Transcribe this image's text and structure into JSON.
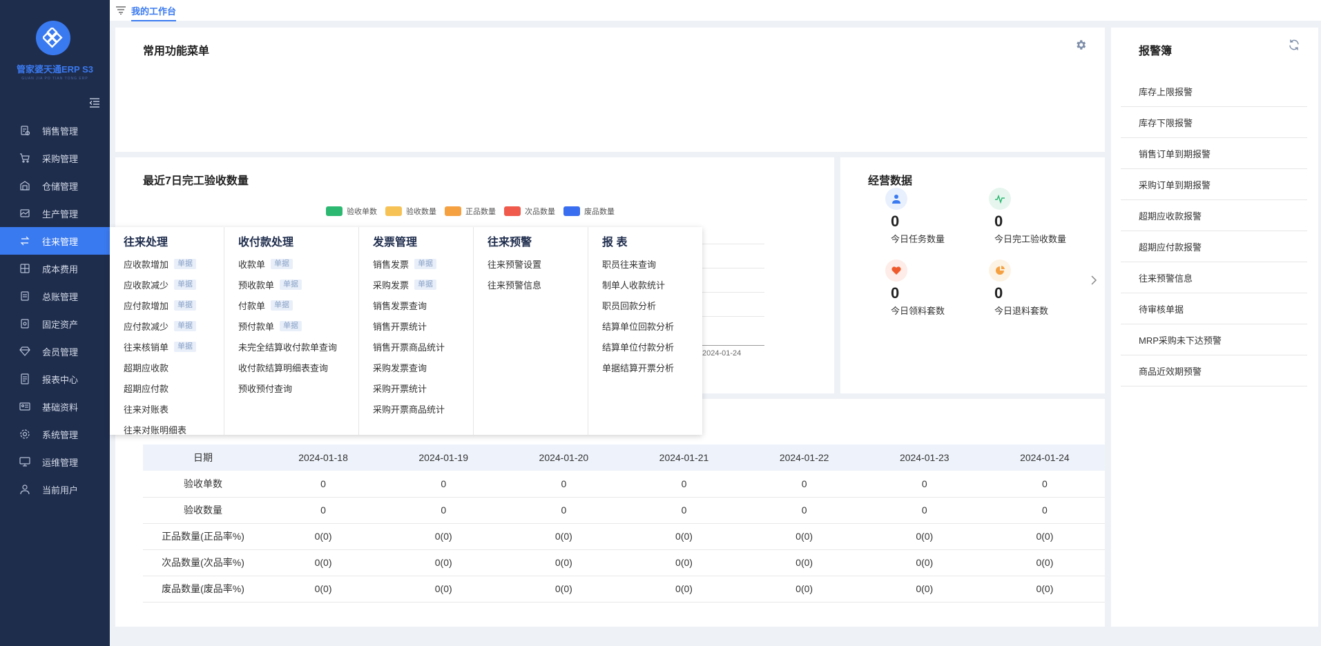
{
  "app": {
    "title": "管家婆天通ERP S3",
    "subtitle": "GUAN JIA PO TIAN TONG ERP"
  },
  "sidebar": {
    "items": [
      {
        "label": "销售管理",
        "icon": "sales-icon"
      },
      {
        "label": "采购管理",
        "icon": "cart-icon"
      },
      {
        "label": "仓储管理",
        "icon": "warehouse-icon"
      },
      {
        "label": "生产管理",
        "icon": "production-icon"
      },
      {
        "label": "往来管理",
        "icon": "exchange-icon",
        "active": true
      },
      {
        "label": "成本费用",
        "icon": "cost-icon"
      },
      {
        "label": "总账管理",
        "icon": "ledger-icon"
      },
      {
        "label": "固定资产",
        "icon": "asset-icon"
      },
      {
        "label": "会员管理",
        "icon": "diamond-icon"
      },
      {
        "label": "报表中心",
        "icon": "report-icon"
      },
      {
        "label": "基础资料",
        "icon": "profile-card-icon"
      },
      {
        "label": "系统管理",
        "icon": "gear-icon"
      },
      {
        "label": "运维管理",
        "icon": "monitor-icon"
      },
      {
        "label": "当前用户",
        "icon": "user-icon"
      }
    ]
  },
  "tabs": {
    "active": "我的工作台"
  },
  "func_panel": {
    "title": "常用功能菜单"
  },
  "chart_panel": {
    "title": "最近7日完工验收数量",
    "x_tick_visible": "2024-01-24"
  },
  "chart_data": {
    "type": "bar",
    "title": "最近7日完工验收数量",
    "categories": [
      "2024-01-18",
      "2024-01-19",
      "2024-01-20",
      "2024-01-21",
      "2024-01-22",
      "2024-01-23",
      "2024-01-24"
    ],
    "series": [
      {
        "name": "验收单数",
        "color": "#2db872",
        "values": [
          0,
          0,
          0,
          0,
          0,
          0,
          0
        ]
      },
      {
        "name": "验收数量",
        "color": "#f7c255",
        "values": [
          0,
          0,
          0,
          0,
          0,
          0,
          0
        ]
      },
      {
        "name": "正品数量",
        "color": "#f5a142",
        "values": [
          0,
          0,
          0,
          0,
          0,
          0,
          0
        ]
      },
      {
        "name": "次品数量",
        "color": "#ef5a4c",
        "values": [
          0,
          0,
          0,
          0,
          0,
          0,
          0
        ]
      },
      {
        "name": "废品数量",
        "color": "#3a6ef0",
        "values": [
          0,
          0,
          0,
          0,
          0,
          0,
          0
        ]
      }
    ],
    "legend": "top-center",
    "grid": true
  },
  "biz_panel": {
    "title": "经营数据",
    "stats": [
      {
        "value": "0",
        "label": "今日任务数量",
        "icon": "person-icon",
        "color": "#3a7af0",
        "bg": "#e8f0fd"
      },
      {
        "value": "0",
        "label": "今日完工验收数量",
        "icon": "activity-icon",
        "color": "#2db872",
        "bg": "#e6f6ee"
      },
      {
        "value": "0",
        "label": "今日领料套数",
        "icon": "heart-icon",
        "color": "#ef5a2c",
        "bg": "#fdece7"
      },
      {
        "value": "0",
        "label": "今日退料套数",
        "icon": "pie-icon",
        "color": "#f5a142",
        "bg": "#fdf3e4"
      }
    ]
  },
  "table": {
    "header": [
      "日期",
      "2024-01-18",
      "2024-01-19",
      "2024-01-20",
      "2024-01-21",
      "2024-01-22",
      "2024-01-23",
      "2024-01-24"
    ],
    "rows": [
      [
        "验收单数",
        "0",
        "0",
        "0",
        "0",
        "0",
        "0",
        "0"
      ],
      [
        "验收数量",
        "0",
        "0",
        "0",
        "0",
        "0",
        "0",
        "0"
      ],
      [
        "正品数量(正品率%)",
        "0(0)",
        "0(0)",
        "0(0)",
        "0(0)",
        "0(0)",
        "0(0)",
        "0(0)"
      ],
      [
        "次品数量(次品率%)",
        "0(0)",
        "0(0)",
        "0(0)",
        "0(0)",
        "0(0)",
        "0(0)",
        "0(0)"
      ],
      [
        "废品数量(废品率%)",
        "0(0)",
        "0(0)",
        "0(0)",
        "0(0)",
        "0(0)",
        "0(0)",
        "0(0)"
      ]
    ]
  },
  "alarm_panel": {
    "title": "报警簿",
    "items": [
      "库存上限报警",
      "库存下限报警",
      "销售订单到期报警",
      "采购订单到期报警",
      "超期应收款报警",
      "超期应付款报警",
      "往来预警信息",
      "待审核单据",
      "MRP采购未下达预警",
      "商品近效期预警"
    ]
  },
  "dropdown": {
    "badge": "单据",
    "columns": [
      {
        "title": "往来处理",
        "items": [
          {
            "label": "应收款增加",
            "badge": true
          },
          {
            "label": "应收款减少",
            "badge": true
          },
          {
            "label": "应付款增加",
            "badge": true
          },
          {
            "label": "应付款减少",
            "badge": true
          },
          {
            "label": "往来核销单",
            "badge": true
          },
          {
            "label": "超期应收款"
          },
          {
            "label": "超期应付款"
          },
          {
            "label": "往来对账表"
          },
          {
            "label": "往来对账明细表"
          }
        ]
      },
      {
        "title": "收付款处理",
        "items": [
          {
            "label": "收款单",
            "badge": true
          },
          {
            "label": "预收款单",
            "badge": true
          },
          {
            "label": "付款单",
            "badge": true
          },
          {
            "label": "预付款单",
            "badge": true
          },
          {
            "label": "未完全结算收付款单查询"
          },
          {
            "label": "收付款结算明细表查询"
          },
          {
            "label": "预收预付查询"
          }
        ]
      },
      {
        "title": "发票管理",
        "items": [
          {
            "label": "销售发票",
            "badge": true
          },
          {
            "label": "采购发票",
            "badge": true
          },
          {
            "label": "销售发票查询"
          },
          {
            "label": "销售开票统计"
          },
          {
            "label": "销售开票商品统计"
          },
          {
            "label": "采购发票查询"
          },
          {
            "label": "采购开票统计"
          },
          {
            "label": "采购开票商品统计"
          }
        ]
      },
      {
        "title": "往来预警",
        "items": [
          {
            "label": "往来预警设置"
          },
          {
            "label": "往来预警信息"
          }
        ]
      },
      {
        "title": "报 表",
        "items": [
          {
            "label": "职员往来查询"
          },
          {
            "label": "制单人收款统计"
          },
          {
            "label": "职员回款分析"
          },
          {
            "label": "结算单位回款分析"
          },
          {
            "label": "结算单位付款分析"
          },
          {
            "label": "单据结算开票分析"
          }
        ]
      }
    ]
  }
}
